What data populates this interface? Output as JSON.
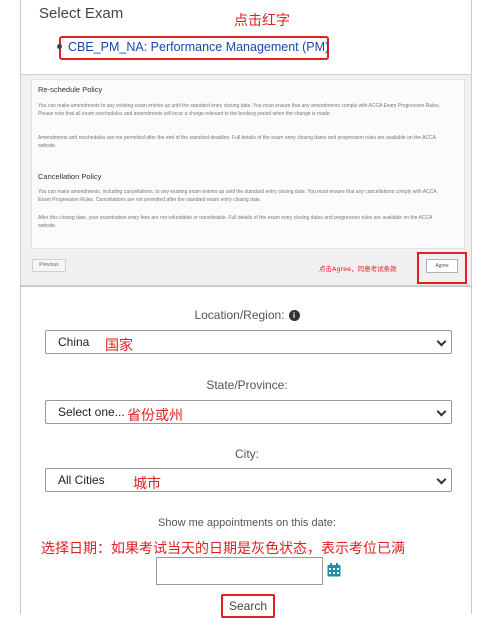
{
  "exam_panel": {
    "title": "Select Exam",
    "annotation": "点击红字",
    "exam_option": "CBE_PM_NA: Performance Management (PM)"
  },
  "policy_panel": {
    "reschedule_heading": "Re-schedule Policy",
    "reschedule_p1": "You can make amendments to any existing exam entries up until the standard entry closing date. You must ensure that any amendments comply with ACCA Exam Progression Rules. Please note that all exam reschedules and amendments will incur a charge relevant to the booking period when the change is made.",
    "reschedule_p2": "Amendments and reschedules are not permitted after the end of the standard deadline. Full details of the exam entry closing dates and progression rules are available on the ACCA website.",
    "cancellation_heading": "Cancellation Policy",
    "cancellation_p1": "You can make amendments, including cancellations, to any existing exam entries up until the standard entry closing date. You must ensure that any cancellations comply with ACCA Exam Progression Rules. Cancellations are not permitted after the standard exam entry closing date.",
    "cancellation_p2": "After this closing date, your examination entry fees are not refundable or transferable. Full details of the exam entry closing dates and progression rules are available on the ACCA website.",
    "previous_label": "Previous",
    "annotation": "点击Agree，同意考试条款",
    "agree_label": "Agree"
  },
  "search_panel": {
    "location_label": "Location/Region:",
    "location_value": "China",
    "location_annotation": "国家",
    "state_label": "State/Province:",
    "state_value": "Select one...",
    "state_annotation": "省份或州",
    "city_label": "City:",
    "city_value": "All Cities",
    "city_annotation": "城市",
    "date_label": "Show me appointments on this date:",
    "date_annotation": "选择日期：如果考试当天的日期是灰色状态，表示考位已满",
    "date_value": "",
    "search_label": "Search"
  },
  "colors": {
    "annotation_red": "#e02020",
    "link_blue": "#1a4aa8",
    "calendar_teal": "#1e8fa6"
  }
}
